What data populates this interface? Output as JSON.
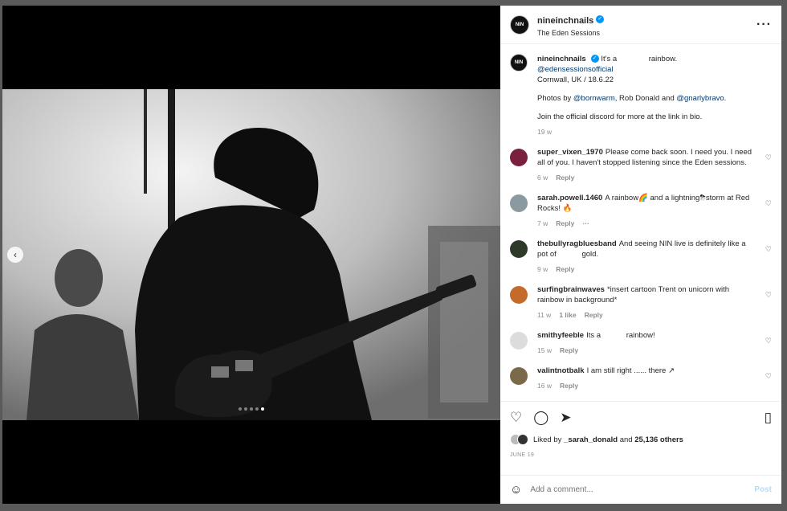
{
  "post": {
    "username": "nineinchnails",
    "avatar_text": "NIN",
    "subtitle": "The Eden Sessions",
    "more_icon": "more-horizontal-icon",
    "caption": {
      "text": "It's a",
      "text2": "rainbow.",
      "mention": "@edensessionsofficial",
      "line2": "Cornwall, UK / 18.6.22",
      "photos_prefix": "Photos by",
      "photos_mention1": "@bornwarm",
      "photos_mid": ", Rob Donald and",
      "photos_mention2": "@gnarlybravo",
      "photos_end": ".",
      "line4": "Join the official discord for more at the link in bio.",
      "time": "19 w"
    },
    "comments": [
      {
        "user": "super_vixen_1970",
        "text": "Please come back soon. I need you. I need all of you. I haven't stopped listening since the Eden sessions.",
        "time": "6 w",
        "reply": "Reply",
        "color": "#7a1f3d"
      },
      {
        "user": "sarah.powell.1460",
        "text": "A rainbow🌈 and a lightning⛈storm at Red Rocks! 🔥",
        "time": "7 w",
        "reply": "Reply",
        "extra": "···",
        "color": "#8a9aa0"
      },
      {
        "user": "thebullyragbluesband",
        "text": "And seeing NIN live is definitely like a pot of            gold.",
        "time": "9 w",
        "reply": "Reply",
        "color": "#2d3a2a"
      },
      {
        "user": "surfingbrainwaves",
        "text": "*insert cartoon Trent on unicorn with rainbow in background*",
        "time": "11 w",
        "likes": "1 like",
        "reply": "Reply",
        "color": "#c46a2a"
      },
      {
        "user": "smithyfeeble",
        "text": "Its a            rainbow!",
        "time": "15 w",
        "reply": "Reply",
        "color": "#dcdcdc"
      },
      {
        "user": "valintnotbalk",
        "text": "I am still right ...... there ↗",
        "time": "16 w",
        "reply": "Reply",
        "color": "#7b6a4a"
      }
    ],
    "likes": {
      "prefix": "Liked by",
      "user": "_sarah_donald",
      "mid": "and",
      "count": "25,136 others"
    },
    "date": "JUNE 19",
    "comment_placeholder": "Add a comment...",
    "post_label": "Post"
  },
  "carousel": {
    "dots": 5,
    "active": 4,
    "prev_icon": "chevron-left-icon"
  },
  "colors": {
    "verified": "#0095f6",
    "link": "#00376b",
    "post_disabled": "#b2dffc"
  }
}
